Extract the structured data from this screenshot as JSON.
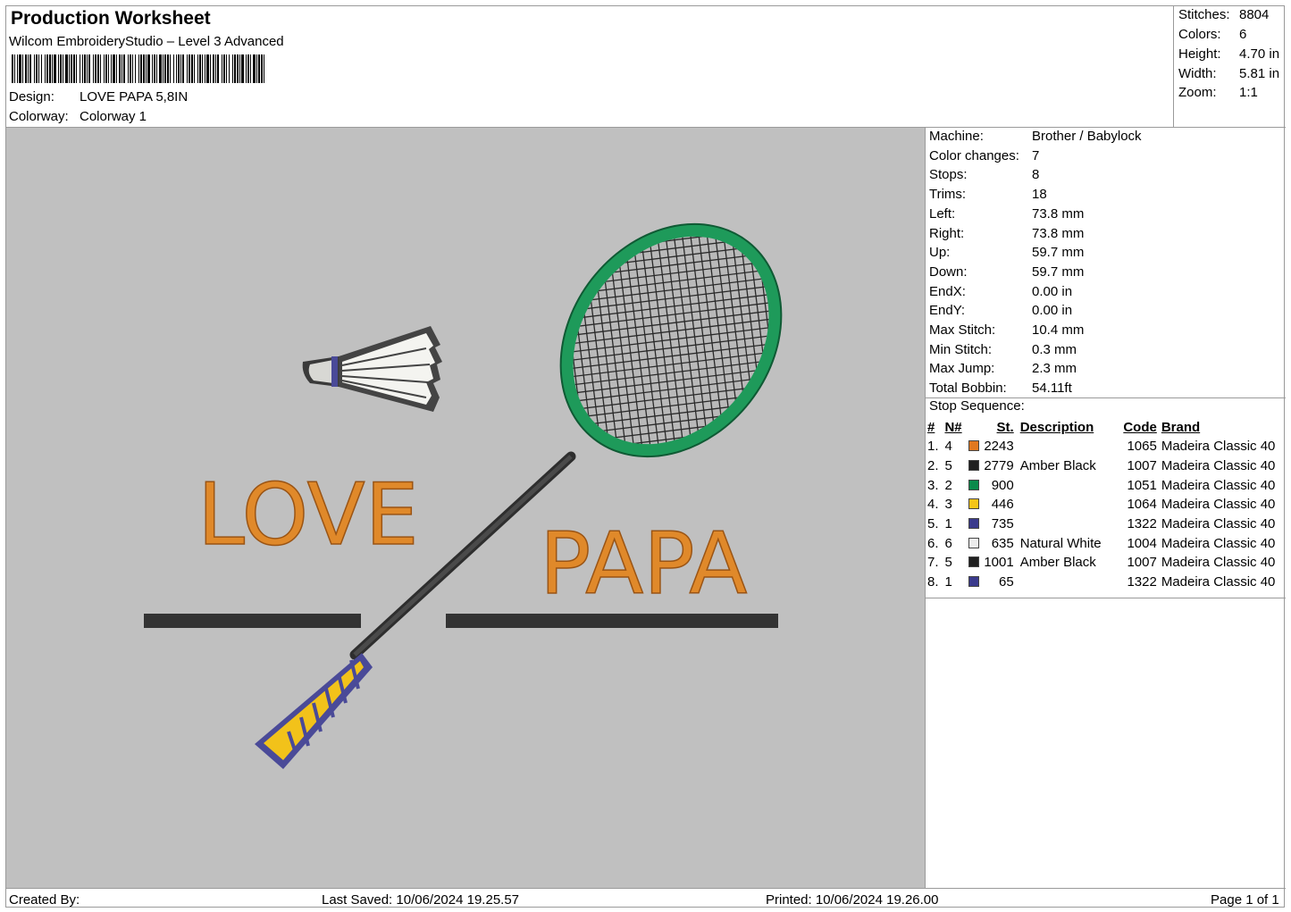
{
  "header": {
    "title": "Production Worksheet",
    "subtitle": "Wilcom EmbroideryStudio – Level 3 Advanced",
    "design_label": "Design:",
    "design_value": "LOVE PAPA 5,8IN",
    "colorway_label": "Colorway:",
    "colorway_value": "Colorway 1"
  },
  "stats": [
    {
      "label": "Stitches:",
      "value": "8804"
    },
    {
      "label": "Colors:",
      "value": "6"
    },
    {
      "label": "Height:",
      "value": "4.70 in"
    },
    {
      "label": "Width:",
      "value": "5.81 in"
    },
    {
      "label": "Zoom:",
      "value": "1:1"
    }
  ],
  "machine_info": [
    {
      "label": "Machine:",
      "value": "Brother / Babylock"
    },
    {
      "label": "Color changes:",
      "value": "7"
    },
    {
      "label": "Stops:",
      "value": "8"
    },
    {
      "label": "Trims:",
      "value": "18"
    },
    {
      "label": "Left:",
      "value": "73.8 mm"
    },
    {
      "label": "Right:",
      "value": "73.8 mm"
    },
    {
      "label": "Up:",
      "value": "59.7 mm"
    },
    {
      "label": "Down:",
      "value": "59.7 mm"
    },
    {
      "label": "EndX:",
      "value": "0.00 in"
    },
    {
      "label": "EndY:",
      "value": "0.00 in"
    },
    {
      "label": "Max Stitch:",
      "value": "10.4 mm"
    },
    {
      "label": "Min Stitch:",
      "value": "0.3 mm"
    },
    {
      "label": "Max Jump:",
      "value": "2.3 mm"
    },
    {
      "label": "Total Bobbin:",
      "value": "54.11ft"
    }
  ],
  "stop_sequence": {
    "title": "Stop Sequence:",
    "columns": [
      "#",
      "N#",
      "St.",
      "Description",
      "Code",
      "Brand"
    ],
    "rows": [
      {
        "idx": "1.",
        "n": "4",
        "color": "#e07820",
        "st": "2243",
        "desc": "",
        "code": "1065",
        "brand": "Madeira Classic 40"
      },
      {
        "idx": "2.",
        "n": "5",
        "color": "#202020",
        "st": "2779",
        "desc": "Amber Black",
        "code": "1007",
        "brand": "Madeira Classic 40"
      },
      {
        "idx": "3.",
        "n": "2",
        "color": "#0a8a4a",
        "st": "900",
        "desc": "",
        "code": "1051",
        "brand": "Madeira Classic 40"
      },
      {
        "idx": "4.",
        "n": "3",
        "color": "#f5c518",
        "st": "446",
        "desc": "",
        "code": "1064",
        "brand": "Madeira Classic 40"
      },
      {
        "idx": "5.",
        "n": "1",
        "color": "#3a3a8c",
        "st": "735",
        "desc": "",
        "code": "1322",
        "brand": "Madeira Classic 40"
      },
      {
        "idx": "6.",
        "n": "6",
        "color": "#ececec",
        "st": "635",
        "desc": "Natural White",
        "code": "1004",
        "brand": "Madeira Classic 40"
      },
      {
        "idx": "7.",
        "n": "5",
        "color": "#202020",
        "st": "1001",
        "desc": "Amber Black",
        "code": "1007",
        "brand": "Madeira Classic 40"
      },
      {
        "idx": "8.",
        "n": "1",
        "color": "#3a3a8c",
        "st": "65",
        "desc": "",
        "code": "1322",
        "brand": "Madeira Classic 40"
      }
    ]
  },
  "design_preview": {
    "word1": "LOVE",
    "word2": "PAPA",
    "colors": {
      "text": "#e0892a",
      "frame": "#1e9a5a",
      "shaft": "#333333",
      "grip": "#f2c21a",
      "grip_border": "#4a4a98",
      "feather": "#f4f4f0"
    }
  },
  "footer": {
    "created_by": "Created By:",
    "last_saved": "Last Saved: 10/06/2024 19.25.57",
    "printed": "Printed: 10/06/2024 19.26.00",
    "page": "Page 1 of 1"
  }
}
